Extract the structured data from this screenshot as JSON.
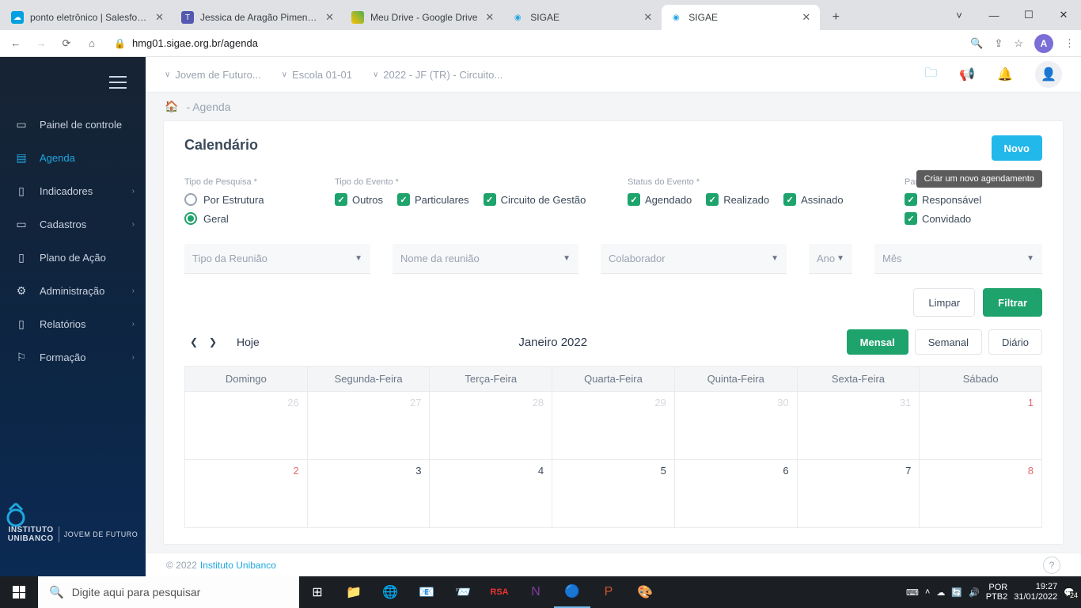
{
  "browser": {
    "tabs": [
      {
        "title": "ponto eletrônico | Salesforce"
      },
      {
        "title": "Jessica de Aragão Pimenta | T"
      },
      {
        "title": "Meu Drive - Google Drive"
      },
      {
        "title": "SIGAE"
      },
      {
        "title": "SIGAE"
      }
    ],
    "url": "hmg01.sigae.org.br/agenda",
    "avatar_letter": "A"
  },
  "sidebar": {
    "items": [
      {
        "label": "Painel de controle"
      },
      {
        "label": "Agenda"
      },
      {
        "label": "Indicadores",
        "expandable": true
      },
      {
        "label": "Cadastros",
        "expandable": true
      },
      {
        "label": "Plano de Ação"
      },
      {
        "label": "Administração",
        "expandable": true
      },
      {
        "label": "Relatórios",
        "expandable": true
      },
      {
        "label": "Formação",
        "expandable": true
      }
    ],
    "brand1": "INSTITUTO",
    "brand2": "UNIBANCO",
    "brand3": "JOVEM DE FUTURO"
  },
  "topbar": {
    "crumb1": "Jovem de Futuro...",
    "crumb2": "Escola 01-01",
    "crumb3": "2022 - JF (TR) - Circuito..."
  },
  "breadcrumb": "- Agenda",
  "card": {
    "title": "Calendário",
    "new_btn": "Novo",
    "tooltip": "Criar um novo agendamento",
    "tipo_pesquisa_label": "Tipo de Pesquisa *",
    "tipo_pesquisa_opts": [
      "Por Estrutura",
      "Geral"
    ],
    "tipo_evento_label": "Tipo do Evento *",
    "tipo_evento_opts": [
      "Outros",
      "Particulares",
      "Circuito de Gestão"
    ],
    "status_label": "Status do Evento *",
    "status_opts": [
      "Agendado",
      "Realizado",
      "Assinado"
    ],
    "participacao_label": "Participação",
    "participacao_opts": [
      "Responsável",
      "Convidado"
    ],
    "selects": {
      "tipo": "Tipo da Reunião",
      "nome": "Nome da reunião",
      "colab": "Colaborador",
      "ano": "Ano",
      "mes": "Mês"
    },
    "btn_clear": "Limpar",
    "btn_filter": "Filtrar",
    "today": "Hoje",
    "month_title": "Janeiro 2022",
    "view_month": "Mensal",
    "view_week": "Semanal",
    "view_day": "Diário",
    "weekdays": [
      "Domingo",
      "Segunda-Feira",
      "Terça-Feira",
      "Quarta-Feira",
      "Quinta-Feira",
      "Sexta-Feira",
      "Sábado"
    ],
    "row1": [
      "26",
      "27",
      "28",
      "29",
      "30",
      "31",
      "1"
    ],
    "row2": [
      "2",
      "3",
      "4",
      "5",
      "6",
      "7",
      "8"
    ]
  },
  "footer": {
    "copyright": "© 2022",
    "link": "Instituto Unibanco"
  },
  "taskbar": {
    "search_placeholder": "Digite aqui para pesquisar",
    "lang1": "POR",
    "lang2": "PTB2",
    "time": "19:27",
    "date": "31/01/2022",
    "notif": "24"
  }
}
